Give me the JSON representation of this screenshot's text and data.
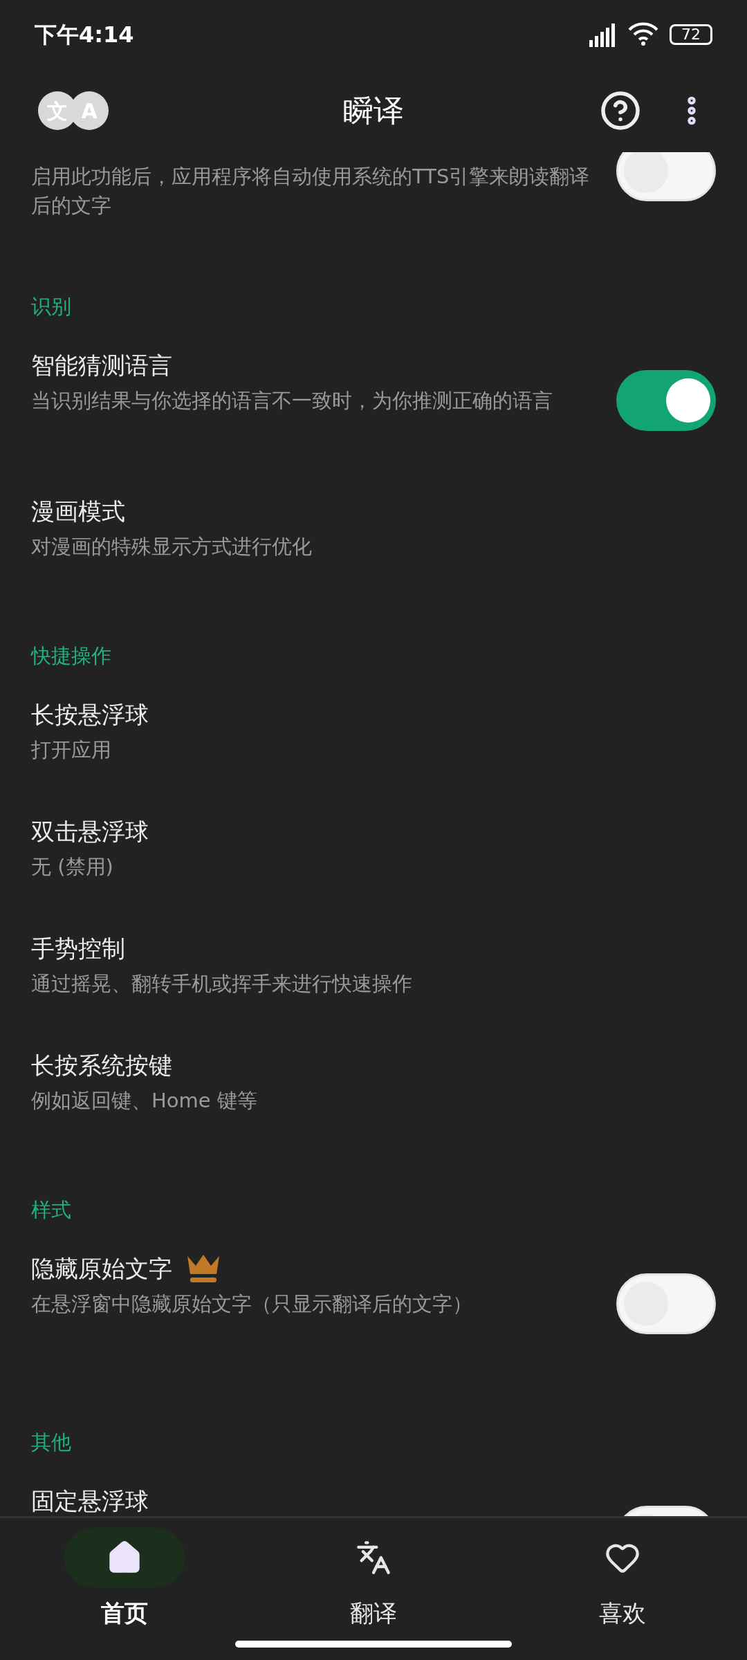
{
  "status_bar": {
    "time": "下午4:14",
    "battery": "72"
  },
  "app_bar": {
    "logo": [
      "文",
      "A"
    ],
    "title": "瞬译"
  },
  "top_item": {
    "description": "启用此功能后，应用程序将自动使用系统的TTS引擎来朗读翻译后的文字",
    "on": false
  },
  "sections": [
    {
      "header": "识别",
      "items": [
        {
          "kind": "switch",
          "title": "智能猜测语言",
          "description": "当识别结果与你选择的语言不一致时，为你推测正确的语言",
          "on": true,
          "premium": false
        },
        {
          "kind": "plain",
          "title": "漫画模式",
          "description": "对漫画的特殊显示方式进行优化",
          "premium": false
        }
      ]
    },
    {
      "header": "快捷操作",
      "items": [
        {
          "kind": "plain",
          "title": "长按悬浮球",
          "description": "打开应用",
          "premium": false
        },
        {
          "kind": "plain",
          "title": "双击悬浮球",
          "description": "无 (禁用)",
          "premium": false
        },
        {
          "kind": "plain",
          "title": "手势控制",
          "description": "通过摇晃、翻转手机或挥手来进行快速操作",
          "premium": false
        },
        {
          "kind": "plain",
          "title": "长按系统按键",
          "description": "例如返回键、Home 键等",
          "premium": false
        }
      ]
    },
    {
      "header": "样式",
      "items": [
        {
          "kind": "switch",
          "title": "隐藏原始文字",
          "description": "在悬浮窗中隐藏原始文字（只显示翻译后的文字）",
          "on": false,
          "premium": true
        }
      ]
    },
    {
      "header": "其他",
      "items": [
        {
          "kind": "switch",
          "title": "固定悬浮球",
          "on": false,
          "premium": false
        }
      ]
    }
  ],
  "nav": [
    {
      "label": "首页",
      "selected": true
    },
    {
      "label": "翻译",
      "selected": false
    },
    {
      "label": "喜欢",
      "selected": false
    }
  ]
}
